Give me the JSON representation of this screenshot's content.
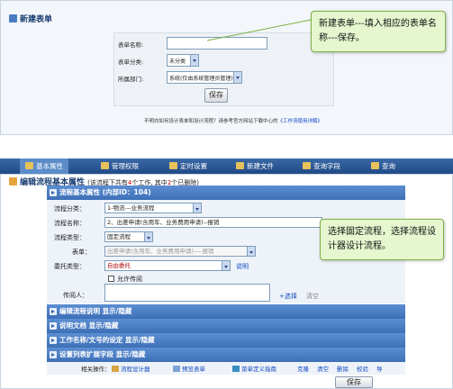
{
  "panel1": {
    "title": "新建表单",
    "fields": [
      {
        "label": "表单名称:",
        "value": ""
      },
      {
        "label": "表单分类:",
        "value": "未分类"
      },
      {
        "label": "所属部门:",
        "value": "系统(仅由系统管理员管理)"
      }
    ],
    "save_label": "保存",
    "help_text": "不明白如何设计表单和设计流程？请参考官方网站下载中心的",
    "help_link": "《工作流使用详解》",
    "callout": "新建表单---填入相应的表单名称---保存。"
  },
  "panel2": {
    "tabs": [
      "基本属性",
      "管理权限",
      "定时设置",
      "新建文件",
      "查询字段",
      "查询"
    ],
    "heading": "编辑流程基本属性",
    "heading_note_prefix": "(该流程下共有",
    "heading_count_total": "4",
    "heading_note_mid": "个工作, 其中",
    "heading_count_deleted": "2",
    "heading_note_suffix": "个已删除)",
    "section_basic": "流程基本属性  (内部ID：104)",
    "rows": {
      "category_label": "流程分类：",
      "category_value": "1-物流---业务流程",
      "name_label": "流程名称：",
      "name_value": "2、出差申请(含用车、业务费用申请)--报销",
      "type_label": "流程类型：",
      "type_value": "固定流程",
      "form_label": "表单：",
      "form_value": "出差申请(含用车、业务费用申请)----报销",
      "delegate_label": "委托类型：",
      "delegate_value": "自由委托",
      "delegate_link": "说明",
      "cc_label": "传阅人：",
      "allow_cc": "允许传阅",
      "add_label": "+选择",
      "clear_label": "清空"
    },
    "sections": [
      "编辑流程说明 显示/隐藏",
      "说明文档 显示/隐藏",
      "工作名称/文号的设定 显示/隐藏",
      "设置列表扩展字段 显示/隐藏"
    ],
    "ops_label": "相关操作：",
    "ops": [
      "流程设计器",
      "预览表单",
      "菜单定义指南",
      "克隆",
      "清空",
      "删除",
      "校验",
      "导"
    ],
    "save_label": "保存",
    "callout": "选择固定流程，选择流程设计器设计流程。"
  }
}
